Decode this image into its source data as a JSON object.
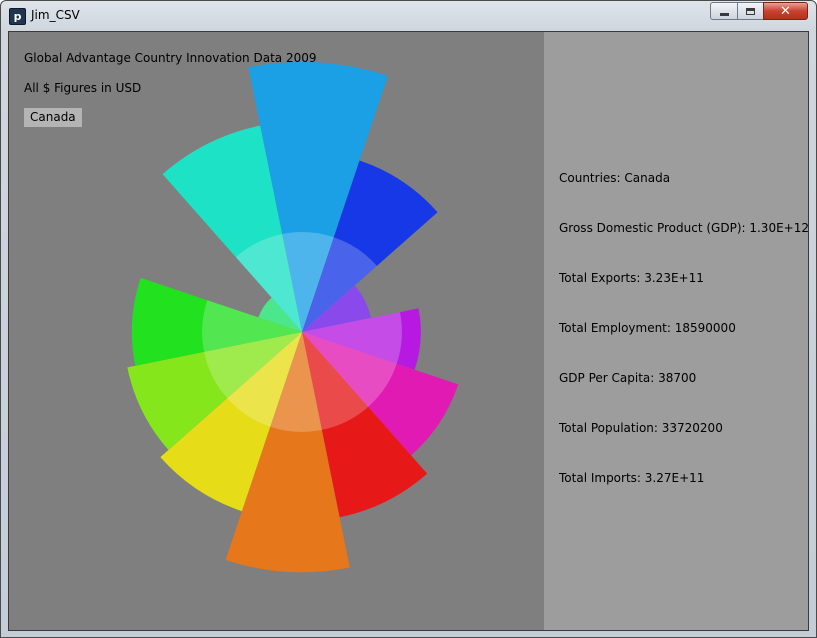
{
  "window": {
    "title": "Jim_CSV",
    "icon_letter": "p",
    "controls": [
      "minimize-icon",
      "maximize-icon",
      "close-icon"
    ]
  },
  "header": {
    "title": "Global Advantage Country Innovation Data 2009",
    "subtitle": "All $ Figures in USD",
    "country_button": "Canada"
  },
  "stats": [
    {
      "label": "Countries: Canada"
    },
    {
      "label": "Gross Domestic Product (GDP): 1.30E+12"
    },
    {
      "label": "Total Exports: 3.23E+11"
    },
    {
      "label": "Total Employment: 18590000"
    },
    {
      "label": "GDP Per Capita: 38700"
    },
    {
      "label": "Total Population: 33720200"
    },
    {
      "label": "Total Imports: 3.27E+11"
    }
  ],
  "chart_data": {
    "type": "polar-area",
    "colors": {
      "background_left": "#7f7f7f",
      "background_right": "#9d9d9d"
    },
    "wedges": [
      {
        "color": "#1ba0e6",
        "value": 1.0
      },
      {
        "color": "#1738e6",
        "value": 0.67
      },
      {
        "color": "#6a17e6",
        "value": 0.26
      },
      {
        "color": "#b61ae0",
        "value": 0.44
      },
      {
        "color": "#e01ab2",
        "value": 0.61
      },
      {
        "color": "#e61818",
        "value": 0.7
      },
      {
        "color": "#e6771b",
        "value": 0.89
      },
      {
        "color": "#e6dd18",
        "value": 0.7
      },
      {
        "color": "#85e61b",
        "value": 0.66
      },
      {
        "color": "#22e11f",
        "value": 0.63
      },
      {
        "color": "#1ae06a",
        "value": 0.17
      },
      {
        "color": "#1de2c6",
        "value": 0.78
      }
    ],
    "inner_ring_fraction": 0.37
  }
}
